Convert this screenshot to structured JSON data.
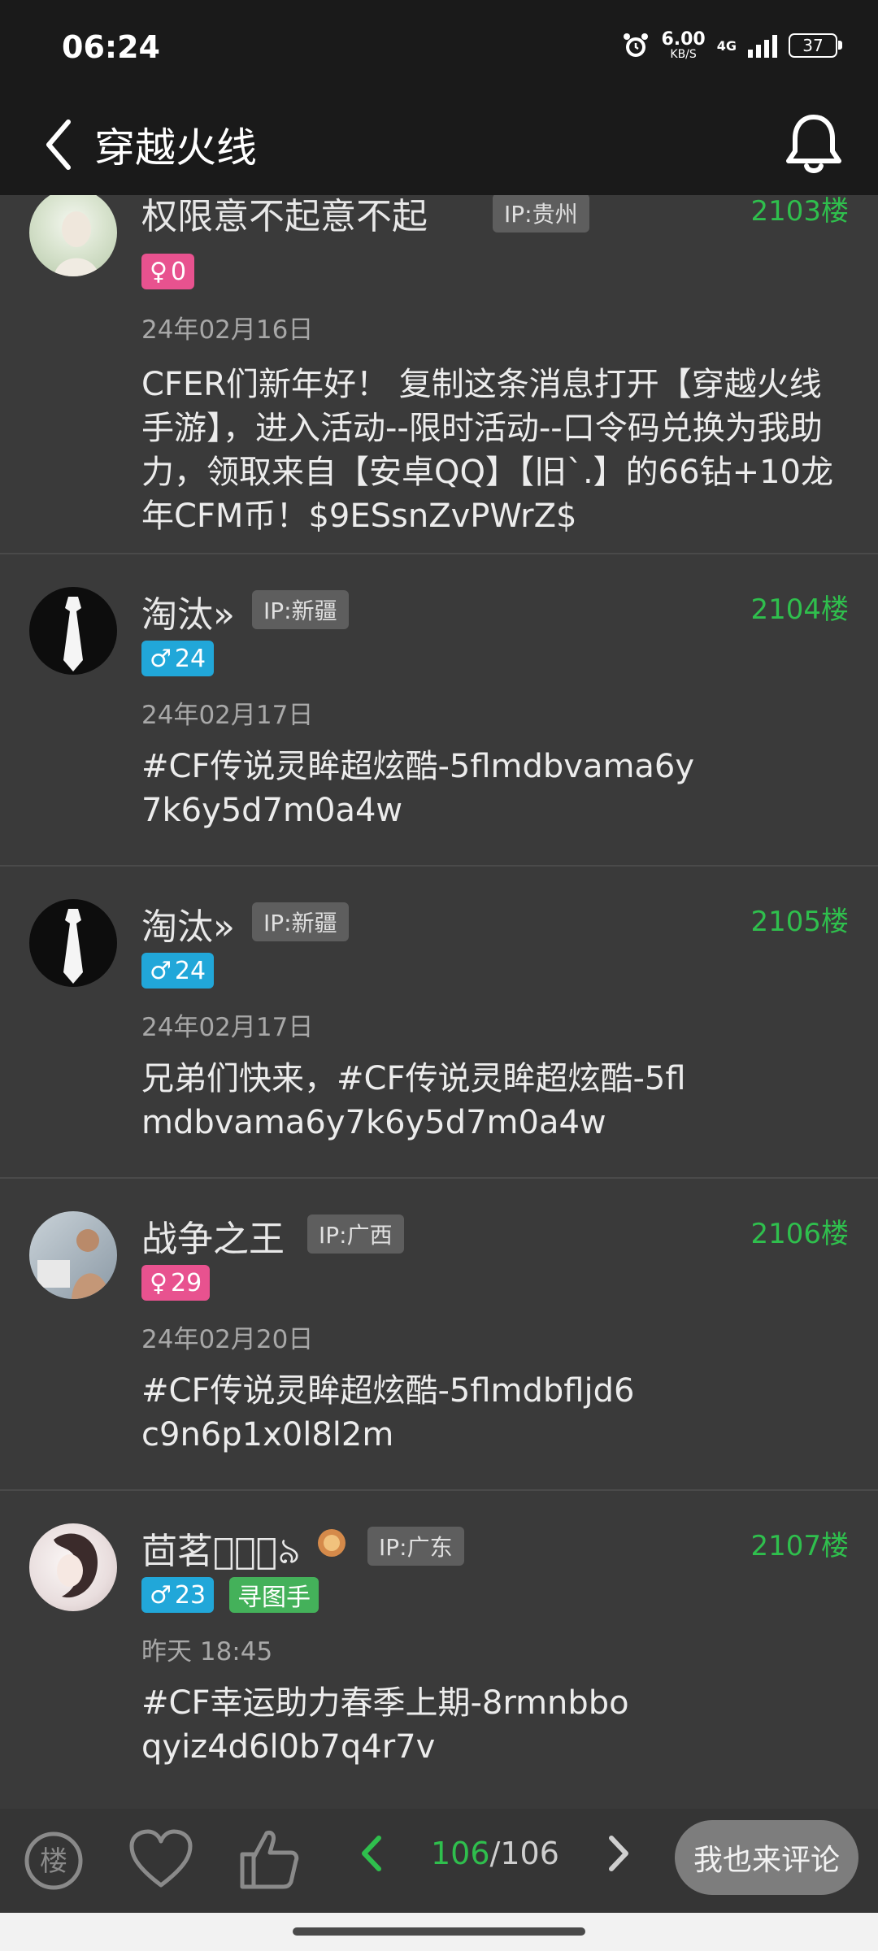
{
  "status_bar": {
    "time": "06:24",
    "net_speed_value": "6.00",
    "net_speed_unit": "KB/S",
    "network": "4G",
    "battery": "37"
  },
  "header": {
    "title": "穿越火线",
    "icons": {
      "back": "back-arrow-icon",
      "bell": "bell-icon"
    }
  },
  "posts": [
    {
      "name": "权限意不起意不起",
      "ip": "IP:贵州",
      "floor": "2103楼",
      "gender_symbol": "♀",
      "level": "0",
      "date": "24年02月16日",
      "content": "CFER们新年好！ 复制这条消息打开【穿越火线手游】，进入活动--限时活动--口令码兑换为我助力，领取来自【安卓QQ】【旧`.】的66钻+10龙年CFM币！$9ESsnZvPWrZ$"
    },
    {
      "name": "淘汰»",
      "ip": "IP:新疆",
      "floor": "2104楼",
      "gender_symbol": "♂",
      "level": "24",
      "date": "24年02月17日",
      "content": "#CF传说灵眸超炫酷-5flmdbvama6y7k6y5d7m0a4w"
    },
    {
      "name": "淘汰»",
      "ip": "IP:新疆",
      "floor": "2105楼",
      "gender_symbol": "♂",
      "level": "24",
      "date": "24年02月17日",
      "content": "兄弟们快来，#CF传说灵眸超炫酷-5flmdbvama6y7k6y5d7m0a4w"
    },
    {
      "name": "战争之王",
      "ip": "IP:广西",
      "floor": "2106楼",
      "gender_symbol": "♀",
      "level": "29",
      "date": "24年02月20日",
      "content": "#CF传说灵眸超炫酷-5flmdbfljd6c9n6p1x0l8l2m"
    },
    {
      "name": "茴茗ঔ⃝ৣ৯",
      "ip": "IP:广东",
      "floor": "2107楼",
      "gender_symbol": "♂",
      "level": "23",
      "extra_badge": "寻图手",
      "date": "昨天 18:45",
      "content": "#CF幸运助力春季上期-8rmnbboqyiz4d6l0b7q4r7v"
    }
  ],
  "bottom_bar": {
    "floor_icon_text": "楼",
    "page_current": "106",
    "page_separator": "/",
    "page_total": "106",
    "comment_button": "我也来评论",
    "icons": {
      "floor": "floor-circle-icon",
      "like": "heart-icon",
      "thumb": "thumbs-up-icon",
      "prev": "chevron-left-icon",
      "next": "chevron-right-icon"
    }
  },
  "colors": {
    "accent_green": "#2fbf4d",
    "female_badge": "#e8528f",
    "male_badge": "#21a7d9",
    "finder_badge": "#44b15a",
    "background": "#3a3a3a"
  }
}
